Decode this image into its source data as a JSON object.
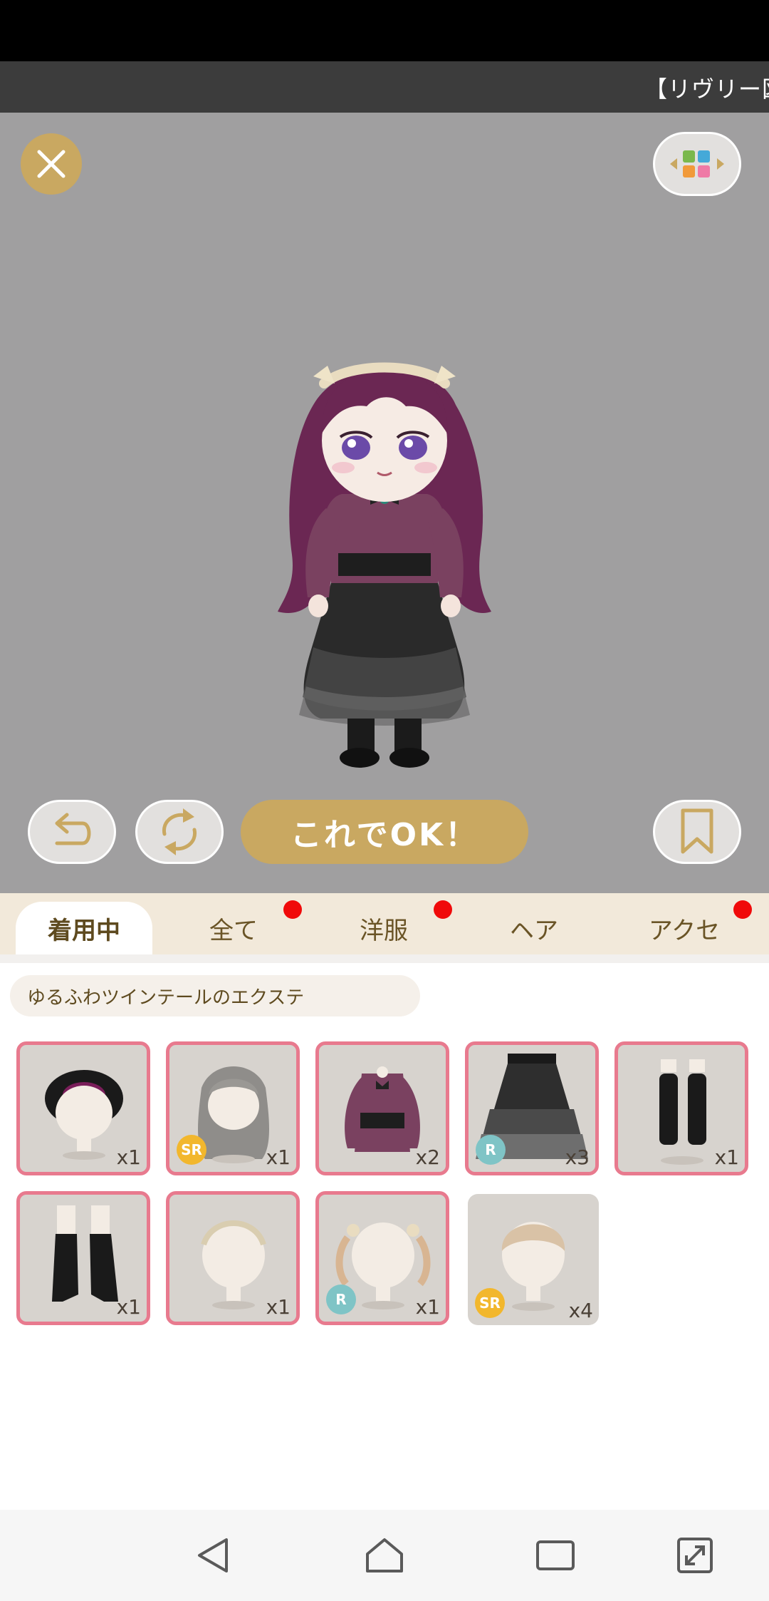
{
  "ticker": {
    "text": "【リヴリー図"
  },
  "buttons": {
    "ok_label": "これでOK！"
  },
  "tabs": [
    {
      "label": "着用中",
      "active": true,
      "dot": false
    },
    {
      "label": "全て",
      "active": false,
      "dot": true
    },
    {
      "label": "洋服",
      "active": false,
      "dot": true
    },
    {
      "label": "ヘア",
      "active": false,
      "dot": false
    },
    {
      "label": "アクセ",
      "active": false,
      "dot": true
    }
  ],
  "selected_item": {
    "name": "ゆるふわツインテールのエクステ"
  },
  "items": [
    {
      "icon": "dark-hair-piece",
      "qty": "x1",
      "rarity": "",
      "worn": true
    },
    {
      "icon": "wavy-long-hair-wig",
      "qty": "x1",
      "rarity": "SR",
      "worn": true
    },
    {
      "icon": "purple-blouse",
      "qty": "x2",
      "rarity": "",
      "worn": true
    },
    {
      "icon": "black-tiered-skirt",
      "qty": "x3",
      "rarity": "R",
      "worn": true
    },
    {
      "icon": "black-fishnet-socks",
      "qty": "x1",
      "rarity": "",
      "worn": true
    },
    {
      "icon": "black-boots",
      "qty": "x1",
      "rarity": "",
      "worn": true
    },
    {
      "icon": "cream-headband",
      "qty": "x1",
      "rarity": "",
      "worn": true
    },
    {
      "icon": "twintail-extensions",
      "qty": "x1",
      "rarity": "R",
      "worn": true
    },
    {
      "icon": "beige-short-hair",
      "qty": "x4",
      "rarity": "SR",
      "worn": false
    }
  ],
  "colors": {
    "accent_gold": "#c9a861",
    "stage_gray": "#a09fa0",
    "worn_border": "#e87a8e",
    "tab_bg": "#f2e9da",
    "notification_dot": "#f00a0a"
  }
}
